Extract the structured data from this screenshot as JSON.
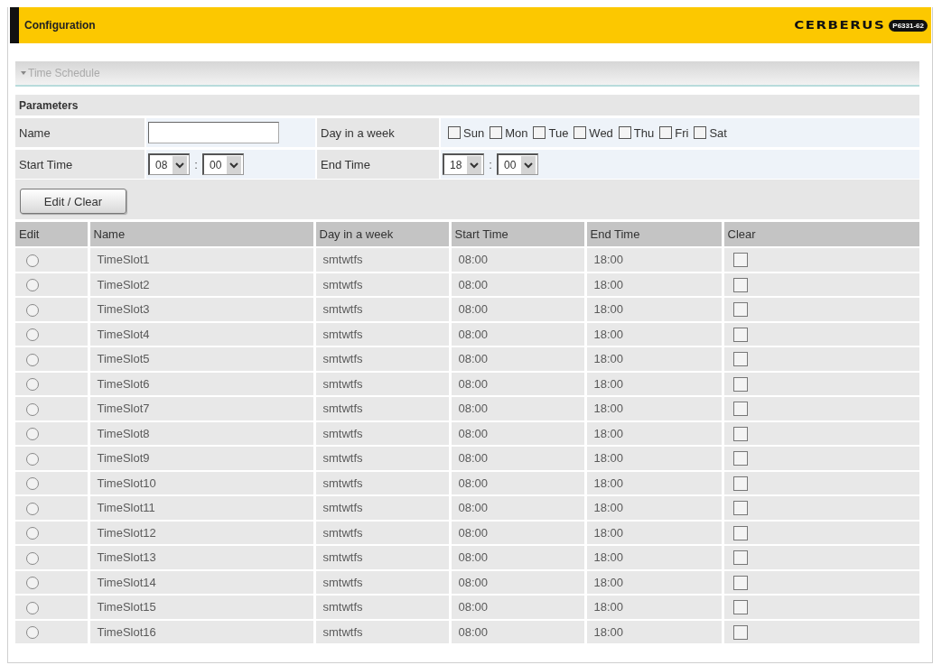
{
  "header": {
    "title": "Configuration",
    "logo": "CERBERUS",
    "model": "P6331-62"
  },
  "panel": {
    "title": "Time Schedule",
    "expanded": true
  },
  "parameters": {
    "heading": "Parameters",
    "name": {
      "label": "Name"
    },
    "days": {
      "label": "Day in a week",
      "options": [
        {
          "label": "Sun",
          "checked": false
        },
        {
          "label": "Mon",
          "checked": false
        },
        {
          "label": "Tue",
          "checked": false
        },
        {
          "label": "Wed",
          "checked": false
        },
        {
          "label": "Thu",
          "checked": false
        },
        {
          "label": "Fri",
          "checked": false
        },
        {
          "label": "Sat",
          "checked": false
        }
      ]
    },
    "start_time": {
      "label": "Start Time",
      "hour": "08",
      "separator": ":",
      "minute": "00"
    },
    "end_time": {
      "label": "End Time",
      "hour": "18",
      "separator": ":",
      "minute": "00"
    },
    "button": "Edit / Clear"
  },
  "table": {
    "columns": [
      "Edit",
      "Name",
      "Day in a week",
      "Start Time",
      "End Time",
      "Clear"
    ],
    "rows": [
      {
        "selected": false,
        "name": "TimeSlot1",
        "days": "smtwtfs",
        "start": "08:00",
        "end": "18:00",
        "clear": false
      },
      {
        "selected": false,
        "name": "TimeSlot2",
        "days": "smtwtfs",
        "start": "08:00",
        "end": "18:00",
        "clear": false
      },
      {
        "selected": false,
        "name": "TimeSlot3",
        "days": "smtwtfs",
        "start": "08:00",
        "end": "18:00",
        "clear": false
      },
      {
        "selected": false,
        "name": "TimeSlot4",
        "days": "smtwtfs",
        "start": "08:00",
        "end": "18:00",
        "clear": false
      },
      {
        "selected": false,
        "name": "TimeSlot5",
        "days": "smtwtfs",
        "start": "08:00",
        "end": "18:00",
        "clear": false
      },
      {
        "selected": false,
        "name": "TimeSlot6",
        "days": "smtwtfs",
        "start": "08:00",
        "end": "18:00",
        "clear": false
      },
      {
        "selected": false,
        "name": "TimeSlot7",
        "days": "smtwtfs",
        "start": "08:00",
        "end": "18:00",
        "clear": false
      },
      {
        "selected": false,
        "name": "TimeSlot8",
        "days": "smtwtfs",
        "start": "08:00",
        "end": "18:00",
        "clear": false
      },
      {
        "selected": false,
        "name": "TimeSlot9",
        "days": "smtwtfs",
        "start": "08:00",
        "end": "18:00",
        "clear": false
      },
      {
        "selected": false,
        "name": "TimeSlot10",
        "days": "smtwtfs",
        "start": "08:00",
        "end": "18:00",
        "clear": false
      },
      {
        "selected": false,
        "name": "TimeSlot11",
        "days": "smtwtfs",
        "start": "08:00",
        "end": "18:00",
        "clear": false
      },
      {
        "selected": false,
        "name": "TimeSlot12",
        "days": "smtwtfs",
        "start": "08:00",
        "end": "18:00",
        "clear": false
      },
      {
        "selected": false,
        "name": "TimeSlot13",
        "days": "smtwtfs",
        "start": "08:00",
        "end": "18:00",
        "clear": false
      },
      {
        "selected": false,
        "name": "TimeSlot14",
        "days": "smtwtfs",
        "start": "08:00",
        "end": "18:00",
        "clear": false
      },
      {
        "selected": false,
        "name": "TimeSlot15",
        "days": "smtwtfs",
        "start": "08:00",
        "end": "18:00",
        "clear": false
      },
      {
        "selected": false,
        "name": "TimeSlot16",
        "days": "smtwtfs",
        "start": "08:00",
        "end": "18:00",
        "clear": false
      }
    ]
  }
}
